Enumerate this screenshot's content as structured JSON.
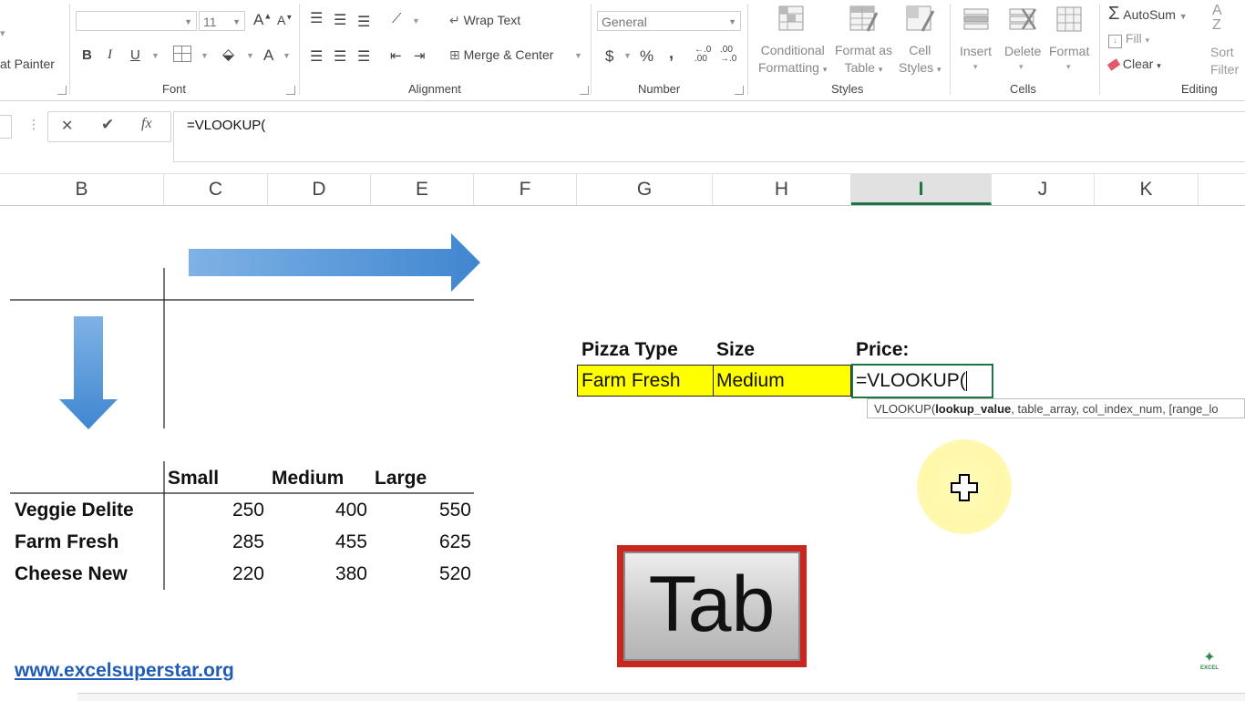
{
  "ribbon": {
    "clipboard": {
      "format_painter": "at Painter"
    },
    "font": {
      "name_value": "",
      "size_value": "11",
      "grow": "A",
      "shrink": "A",
      "bold": "B",
      "italic": "I",
      "underline": "U",
      "font_color": "A",
      "label": "Font"
    },
    "alignment": {
      "wrap_text": "Wrap Text",
      "merge_center": "Merge & Center",
      "label": "Alignment"
    },
    "number": {
      "format_value": "General",
      "currency": "$",
      "percent": "%",
      "comma": ",",
      "label": "Number"
    },
    "styles": {
      "conditional": [
        "Conditional",
        "Formatting"
      ],
      "format_table": [
        "Format as",
        "Table"
      ],
      "cell_styles": [
        "Cell",
        "Styles"
      ],
      "label": "Styles"
    },
    "cells": {
      "insert": "Insert",
      "delete": "Delete",
      "format": "Format",
      "label": "Cells"
    },
    "editing": {
      "autosum": "AutoSum",
      "fill": "Fill",
      "clear": "Clear",
      "sort_filter": [
        "Sort",
        "Filter"
      ],
      "label": "Editing"
    }
  },
  "formula_bar": {
    "cancel": "✕",
    "enter": "✔",
    "fx": "fx",
    "formula": "=VLOOKUP("
  },
  "columns": [
    {
      "label": "B",
      "selected": false
    },
    {
      "label": "C",
      "selected": false
    },
    {
      "label": "D",
      "selected": false
    },
    {
      "label": "E",
      "selected": false
    },
    {
      "label": "F",
      "selected": false
    },
    {
      "label": "G",
      "selected": false
    },
    {
      "label": "H",
      "selected": false
    },
    {
      "label": "I",
      "selected": true
    },
    {
      "label": "J",
      "selected": false
    },
    {
      "label": "K",
      "selected": false
    }
  ],
  "table": {
    "headers": [
      "Small",
      "Medium",
      "Large"
    ],
    "rows": [
      {
        "name": "Veggie Delite",
        "values": [
          "250",
          "400",
          "550"
        ]
      },
      {
        "name": "Farm Fresh",
        "values": [
          "285",
          "455",
          "625"
        ]
      },
      {
        "name": "Cheese New",
        "values": [
          "220",
          "380",
          "520"
        ]
      }
    ]
  },
  "lookup": {
    "pizza_type_label": "Pizza Type",
    "size_label": "Size",
    "price_label": "Price:",
    "pizza_type_value": "Farm Fresh",
    "size_value": "Medium",
    "price_formula": "=VLOOKUP("
  },
  "tooltip": {
    "fn": "VLOOKUP(",
    "bold_arg": "lookup_value",
    "rest": ", table_array, col_index_num, [range_lo"
  },
  "key_overlay": {
    "label": "Tab"
  },
  "website": "www.excelsuperstar.org",
  "watermark": "EXCEL",
  "colors": {
    "highlight": "#ffff00",
    "excel_green": "#217346",
    "arrow_blue": "#4a8fd6",
    "key_border": "#c8261e",
    "link": "#1f5cb8"
  }
}
